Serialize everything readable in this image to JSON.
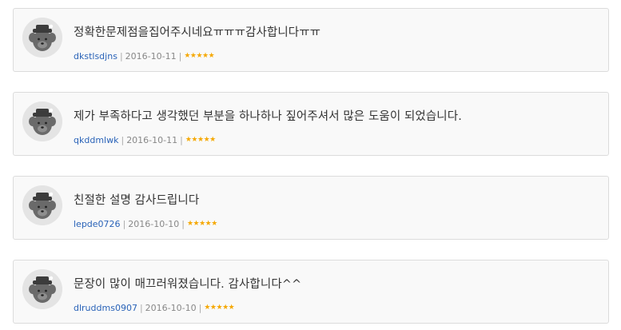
{
  "reviews": [
    {
      "text": "정확한문제점을집어주시네요ㅠㅠㅠ감사합니다ㅠㅠ",
      "user": "dkstlsdjns",
      "date": "2016-10-11",
      "rating": 5
    },
    {
      "text": "제가 부족하다고 생각했던 부분을 하나하나 짚어주셔서 많은 도움이 되었습니다.",
      "user": "qkddmlwk",
      "date": "2016-10-11",
      "rating": 5
    },
    {
      "text": "친절한 설명 감사드립니다",
      "user": "lepde0726",
      "date": "2016-10-10",
      "rating": 5
    },
    {
      "text": "문장이 많이 매끄러워졌습니다. 감사합니다^^",
      "user": "dlruddms0907",
      "date": "2016-10-10",
      "rating": 5
    }
  ],
  "separator": "|",
  "star_glyph": "★",
  "star_color": "#f5a800",
  "user_color": "#2a63b8",
  "avatar_icon": "default-avatar-icon"
}
